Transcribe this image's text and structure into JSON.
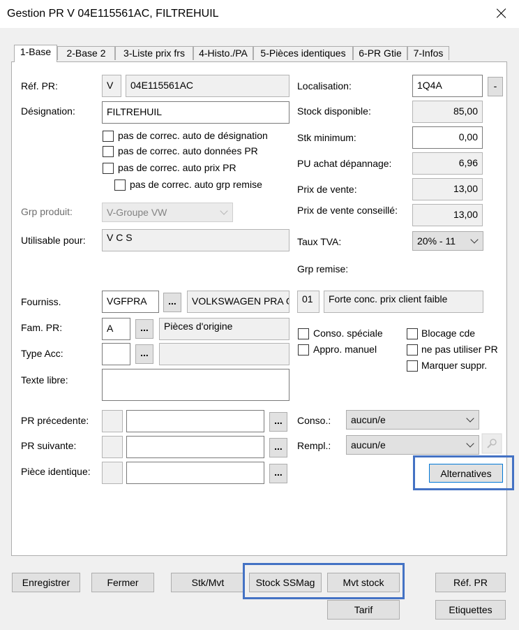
{
  "window": {
    "title": "Gestion PR   V 04E115561AC, FILTREHUIL"
  },
  "tabs": [
    {
      "label": "1-Base"
    },
    {
      "label": "2-Base 2"
    },
    {
      "label": "3-Liste prix frs"
    },
    {
      "label": "4-Histo./PA"
    },
    {
      "label": "5-Pièces identiques"
    },
    {
      "label": "6-PR Gtie"
    },
    {
      "label": "7-Infos"
    }
  ],
  "left": {
    "ref_pr": {
      "label": "Réf. PR:",
      "prefix": "V",
      "value": "04E115561AC"
    },
    "designation": {
      "label": "Désignation:",
      "value": "FILTREHUIL"
    },
    "checks": [
      {
        "label": "pas de correc. auto de désignation",
        "checked": false
      },
      {
        "label": "pas de correc. auto données PR",
        "checked": false
      },
      {
        "label": "pas de correc. auto prix PR",
        "checked": false
      },
      {
        "label": "pas de correc. auto grp remise",
        "checked": false
      }
    ],
    "grp_produit": {
      "label": "Grp produit:",
      "value": "V-Groupe VW"
    },
    "utilisable": {
      "label": "Utilisable pour:",
      "value": "V C S"
    },
    "fourniss": {
      "label": "Fourniss.",
      "code": "VGFPRA",
      "dots": "...",
      "name": "VOLKSWAGEN PRA G"
    },
    "fam_pr": {
      "label": "Fam. PR:",
      "code": "A",
      "dots": "...",
      "name": "Pièces d'origine"
    },
    "type_acc": {
      "label": "Type Acc:",
      "code": "",
      "dots": "...",
      "name": ""
    },
    "texte_libre": {
      "label": "Texte libre:",
      "value": ""
    },
    "pr_precedente": {
      "label": "PR précedente:",
      "dots": "..."
    },
    "pr_suivante": {
      "label": "PR suivante:",
      "dots": "..."
    },
    "piece_identique": {
      "label": "Pièce identique:",
      "dots": "..."
    }
  },
  "right": {
    "localisation": {
      "label": "Localisation:",
      "value": "1Q4A",
      "button": "-"
    },
    "stock_disponible": {
      "label": "Stock disponible:",
      "value": "85,00"
    },
    "stk_minimum": {
      "label": "Stk minimum:",
      "value": "0,00"
    },
    "pu_achat": {
      "label": "PU achat dépannage:",
      "value": "6,96"
    },
    "prix_vente": {
      "label": "Prix de vente:",
      "value": "13,00"
    },
    "prix_vente_conseille": {
      "label": "Prix de vente conseillé:",
      "value": "13,00"
    },
    "taux_tva": {
      "label": "Taux TVA:",
      "value": "20% - 11"
    },
    "grp_remise": {
      "label": "Grp remise:",
      "code": "01",
      "desc": "Forte conc. prix client faible"
    },
    "checks_a": [
      {
        "label": "Conso. spéciale",
        "checked": false
      },
      {
        "label": "Appro. manuel",
        "checked": false
      }
    ],
    "checks_b": [
      {
        "label": "Blocage cde",
        "checked": false
      },
      {
        "label": "ne pas utiliser PR",
        "checked": false
      },
      {
        "label": "Marquer suppr.",
        "checked": false
      }
    ],
    "conso": {
      "label": "Conso.:",
      "value": "aucun/e"
    },
    "rempl": {
      "label": "Rempl.:",
      "value": "aucun/e"
    },
    "alternatives": "Alternatives"
  },
  "footer": {
    "enregistrer": "Enregistrer",
    "fermer": "Fermer",
    "stk_mvt": "Stk/Mvt",
    "stock_ssmag": "Stock SSMag",
    "mvt_stock": "Mvt stock",
    "tarif": "Tarif",
    "ref_pr": "Réf. PR",
    "etiquettes": "Etiquettes"
  },
  "colors": {
    "highlight": "#4472c4",
    "panel": "#ffffff",
    "window": "#f0f0f0"
  }
}
